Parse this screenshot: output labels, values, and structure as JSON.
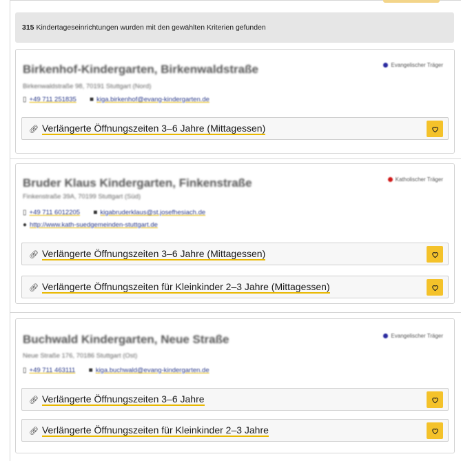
{
  "results": {
    "count": "315",
    "text": "Kindertageseinrichtungen wurden mit den gewählten Kriterien gefunden"
  },
  "colors": {
    "accent": "#f4c22a",
    "evangelisch": "#2a2aa0",
    "katholisch": "#d01818"
  },
  "cards": [
    {
      "title": "Birkenhof-Kindergarten, Birkenwaldstraße",
      "badge": "Evangelischer Träger",
      "address": "Birkenwaldstraße 98, 70191 Stuttgart (Nord)",
      "phone": "+49 711 251835",
      "email": "kiga.birkenhof@evang-kindergarten.de",
      "offers": [
        "Verlängerte Öffnungszeiten 3–6 Jahre (Mittagessen)"
      ]
    },
    {
      "title": "Bruder Klaus Kindergarten, Finkenstraße",
      "badge": "Katholischer Träger",
      "address": "Finkenstraße 39A, 70199 Stuttgart (Süd)",
      "phone": "+49 711 6012205",
      "email": "kigabruderklaus@st.josefhesiach.de",
      "web": "http://www.kath-suedgemeinden-stuttgart.de",
      "offers": [
        "Verlängerte Öffnungszeiten 3–6 Jahre (Mittagessen)",
        "Verlängerte Öffnungszeiten für Kleinkinder 2–3 Jahre (Mittagessen)"
      ]
    },
    {
      "title": "Buchwald Kindergarten, Neue Straße",
      "badge": "Evangelischer Träger",
      "address": "Neue Straße 176, 70186 Stuttgart (Ost)",
      "phone": "+49 711 463111",
      "email": "kiga.buchwald@evang-kindergarten.de",
      "offers": [
        "Verlängerte Öffnungszeiten 3–6 Jahre",
        "Verlängerte Öffnungszeiten für Kleinkinder 2–3 Jahre"
      ]
    }
  ]
}
